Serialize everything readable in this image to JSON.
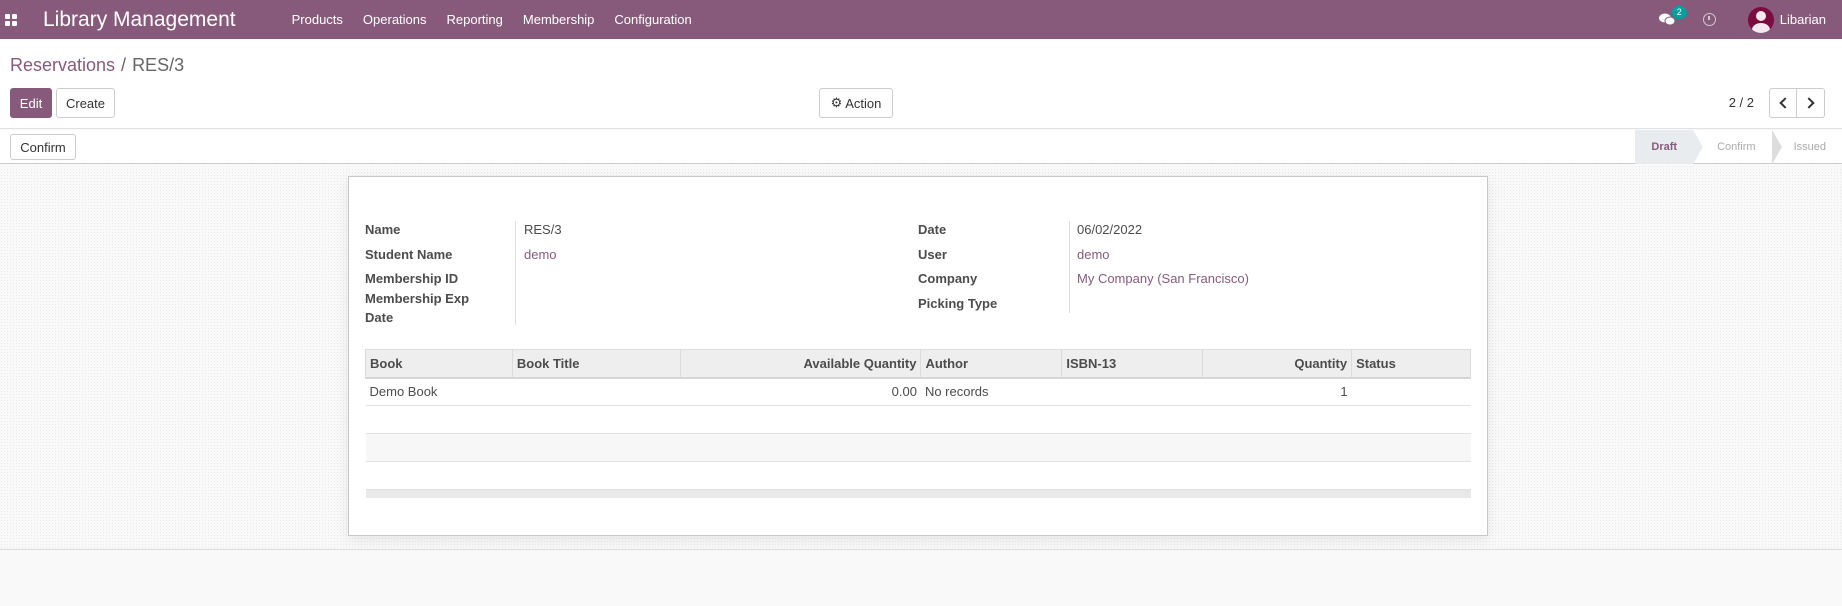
{
  "navbar": {
    "brand": "Library Management",
    "menu": [
      "Products",
      "Operations",
      "Reporting",
      "Membership",
      "Configuration"
    ],
    "chat_count": "2",
    "user": "Libarian"
  },
  "breadcrumb": {
    "parent": "Reservations",
    "separator": "/",
    "current": "RES/3"
  },
  "buttons": {
    "edit": "Edit",
    "create": "Create",
    "action": "Action",
    "confirm": "Confirm"
  },
  "pager": {
    "value": "2 / 2"
  },
  "statusbar": {
    "steps": [
      "Draft",
      "Confirm",
      "Issued"
    ],
    "active": "Draft"
  },
  "form": {
    "left": [
      {
        "label": "Name",
        "value": "RES/3"
      },
      {
        "label": "Student Name",
        "value": "demo"
      },
      {
        "label": "Membership ID",
        "value": ""
      },
      {
        "label": "Membership Exp Date",
        "value": ""
      }
    ],
    "right": [
      {
        "label": "Date",
        "value": "06/02/2022"
      },
      {
        "label": "User",
        "value": "demo"
      },
      {
        "label": "Company",
        "value": "My Company (San Francisco)"
      },
      {
        "label": "Picking Type",
        "value": ""
      }
    ]
  },
  "table": {
    "columns": [
      "Book",
      "Book Title",
      "Available Quantity",
      "Author",
      "ISBN-13",
      "Quantity",
      "Status"
    ],
    "rows": [
      {
        "book": "Demo Book",
        "book_title": "",
        "available_quantity": "0.00",
        "author": "No records",
        "isbn": "",
        "quantity": "1",
        "status": ""
      }
    ]
  },
  "colors": {
    "brand": "#875a7b",
    "badge": "#00a09d"
  }
}
